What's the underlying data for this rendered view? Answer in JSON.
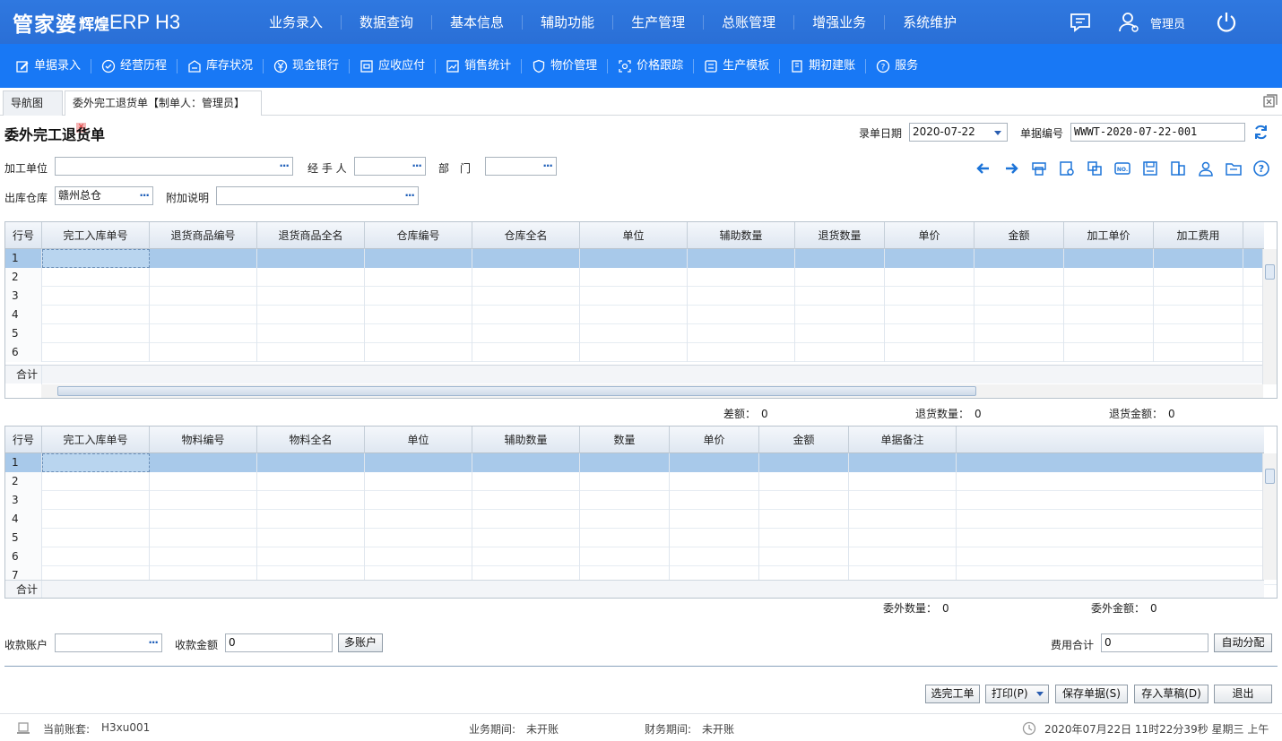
{
  "app": {
    "logo_main": "管家婆",
    "logo_sub": "辉煌",
    "logo_product": "ERP H3",
    "user_name": "管理员"
  },
  "main_menu": [
    "业务录入",
    "数据查询",
    "基本信息",
    "辅助功能",
    "生产管理",
    "总账管理",
    "增强业务",
    "系统维护"
  ],
  "sub_menu": [
    {
      "label": "单据录入",
      "icon": "edit-icon"
    },
    {
      "label": "经营历程",
      "icon": "check-circle-icon"
    },
    {
      "label": "库存状况",
      "icon": "warehouse-icon"
    },
    {
      "label": "现金银行",
      "icon": "yuan-icon"
    },
    {
      "label": "应收应付",
      "icon": "ledger-icon"
    },
    {
      "label": "销售统计",
      "icon": "stats-icon"
    },
    {
      "label": "物价管理",
      "icon": "shield-icon"
    },
    {
      "label": "价格跟踪",
      "icon": "tracking-icon"
    },
    {
      "label": "生产模板",
      "icon": "template-icon"
    },
    {
      "label": "期初建账",
      "icon": "book-icon"
    },
    {
      "label": "服务",
      "icon": "help-icon"
    }
  ],
  "tabs": {
    "nav_tab": "导航图",
    "doc_tab": "委外完工退货单【制单人：管理员】"
  },
  "form": {
    "title": "委外完工退货单",
    "date_label": "录单日期",
    "date_value": "2020-07-22",
    "docno_label": "单据编号",
    "docno_value": "WWWT-2020-07-22-001",
    "processor_label": "加工单位",
    "processor_value": "",
    "handler_label": "经 手 人",
    "handler_value": "",
    "dept_label": "部　门",
    "dept_value": "",
    "warehouse_label": "出库仓库",
    "warehouse_value": "赣州总仓",
    "note_label": "附加说明",
    "note_value": "",
    "ellipsis": "···"
  },
  "grid1": {
    "columns": [
      "行号",
      "完工入库单号",
      "退货商品编号",
      "退货商品全名",
      "仓库编号",
      "仓库全名",
      "单位",
      "辅助数量",
      "退货数量",
      "单价",
      "金额",
      "加工单价",
      "加工费用"
    ],
    "rows": [
      "1",
      "2",
      "3",
      "4",
      "5",
      "6"
    ],
    "sum_label": "合计"
  },
  "grid1_stats": {
    "diff_label": "差额：",
    "diff_value": "0",
    "qty_label": "退货数量：",
    "qty_value": "0",
    "amount_label": "退货金额：",
    "amount_value": "0"
  },
  "grid2": {
    "columns": [
      "行号",
      "完工入库单号",
      "物料编号",
      "物料全名",
      "单位",
      "辅助数量",
      "数量",
      "单价",
      "金额",
      "单据备注"
    ],
    "rows": [
      "1",
      "2",
      "3",
      "4",
      "5",
      "6",
      "7"
    ],
    "sum_label": "合计"
  },
  "grid2_stats": {
    "qty_label": "委外数量：",
    "qty_value": "0",
    "amount_label": "委外金额：",
    "amount_value": "0"
  },
  "payment": {
    "account_label": "收款账户",
    "account_value": "",
    "amount_label": "收款金额",
    "amount_value": "0",
    "multi_button": "多账户",
    "fee_label": "费用合计",
    "fee_value": "0",
    "auto_button": "自动分配"
  },
  "actions": {
    "select_button": "选完工单",
    "print_button": "打印(P)",
    "save_button": "保存单据(S)",
    "draft_button": "存入草稿(D)",
    "exit_button": "退出"
  },
  "status": {
    "account_label": "当前账套:",
    "account_value": "H3xu001",
    "business_period_label": "业务期间:",
    "business_period_value": "未开账",
    "finance_period_label": "财务期间:",
    "finance_period_value": "未开账",
    "datetime": "2020年07月22日 11时22分39秒 星期三 上午"
  }
}
